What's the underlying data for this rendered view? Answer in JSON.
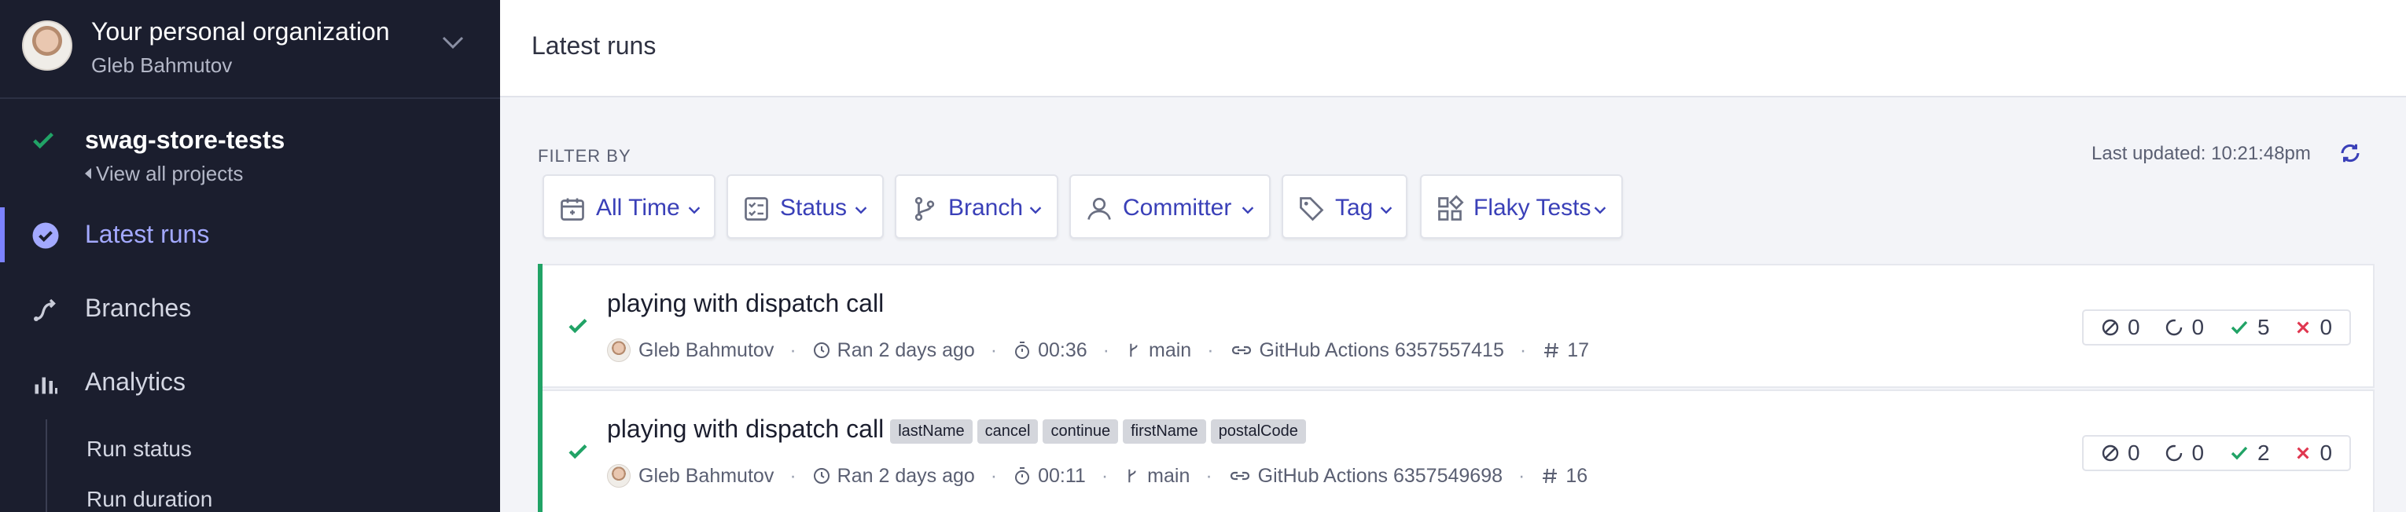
{
  "org": {
    "name": "Your personal organization",
    "user": "Gleb Bahmutov"
  },
  "project": {
    "name": "swag-store-tests",
    "view_all": "View all projects"
  },
  "nav": {
    "latest_runs": "Latest runs",
    "branches": "Branches",
    "analytics": "Analytics",
    "sub": [
      "Run status",
      "Run duration"
    ]
  },
  "header": {
    "title": "Latest runs"
  },
  "filters": {
    "label": "FILTER BY",
    "last_updated": "Last updated: 10:21:48pm",
    "items": [
      "All Time",
      "Status",
      "Branch",
      "Committer",
      "Tag",
      "Flaky Tests"
    ]
  },
  "runs": [
    {
      "title": "playing with dispatch call",
      "tags": [],
      "committer": "Gleb Bahmutov",
      "ran": "Ran 2 days ago",
      "duration": "00:36",
      "branch": "main",
      "ci": "GitHub Actions 6357557415",
      "number": "17",
      "skipped": "0",
      "pending": "0",
      "passed": "5",
      "failed": "0"
    },
    {
      "title": "playing with dispatch call",
      "tags": [
        "lastName",
        "cancel",
        "continue",
        "firstName",
        "postalCode"
      ],
      "committer": "Gleb Bahmutov",
      "ran": "Ran 2 days ago",
      "duration": "00:11",
      "branch": "main",
      "ci": "GitHub Actions 6357549698",
      "number": "16",
      "skipped": "0",
      "pending": "0",
      "passed": "2",
      "failed": "0"
    }
  ],
  "colors": {
    "sidebar_bg": "#1b1e2e",
    "accent": "#7c82ff",
    "success": "#21a366",
    "fail": "#e0364f",
    "filter_text": "#3a40b8"
  }
}
